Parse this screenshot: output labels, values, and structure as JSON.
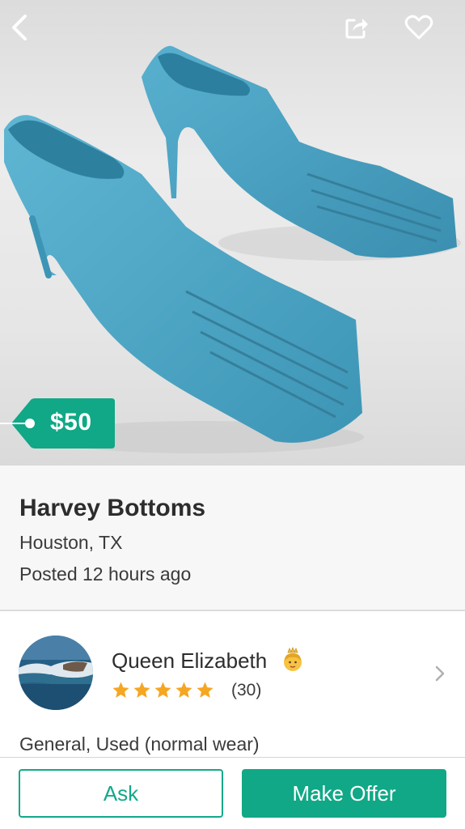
{
  "listing": {
    "price": "$50",
    "title": "Harvey Bottoms",
    "location": "Houston, TX",
    "posted": "Posted 12 hours ago",
    "condition": "General, Used (normal wear)"
  },
  "seller": {
    "name": "Queen Elizabeth",
    "name_emoji": "princess-emoji",
    "rating_stars": 5,
    "rating_count": "(30)"
  },
  "actions": {
    "ask_label": "Ask",
    "offer_label": "Make Offer"
  },
  "icons": {
    "back": "back-chevron-icon",
    "share": "share-icon",
    "favorite": "heart-icon",
    "star": "star-icon",
    "chevron": "chevron-right-icon"
  },
  "colors": {
    "accent": "#10a886",
    "star": "#f5a623",
    "product": "#4aa3c2"
  }
}
